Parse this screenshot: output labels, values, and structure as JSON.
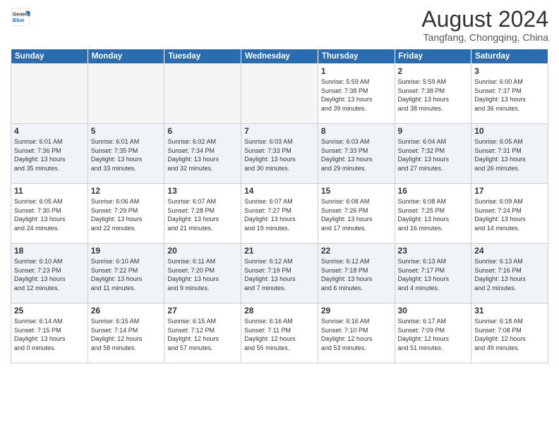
{
  "header": {
    "logo_line1": "General",
    "logo_line2": "Blue",
    "month_year": "August 2024",
    "location": "Tangfang, Chongqing, China"
  },
  "weekdays": [
    "Sunday",
    "Monday",
    "Tuesday",
    "Wednesday",
    "Thursday",
    "Friday",
    "Saturday"
  ],
  "weeks": [
    [
      {
        "day": "",
        "info": ""
      },
      {
        "day": "",
        "info": ""
      },
      {
        "day": "",
        "info": ""
      },
      {
        "day": "",
        "info": ""
      },
      {
        "day": "1",
        "info": "Sunrise: 5:59 AM\nSunset: 7:38 PM\nDaylight: 13 hours\nand 39 minutes."
      },
      {
        "day": "2",
        "info": "Sunrise: 5:59 AM\nSunset: 7:38 PM\nDaylight: 13 hours\nand 38 minutes."
      },
      {
        "day": "3",
        "info": "Sunrise: 6:00 AM\nSunset: 7:37 PM\nDaylight: 13 hours\nand 36 minutes."
      }
    ],
    [
      {
        "day": "4",
        "info": "Sunrise: 6:01 AM\nSunset: 7:36 PM\nDaylight: 13 hours\nand 35 minutes."
      },
      {
        "day": "5",
        "info": "Sunrise: 6:01 AM\nSunset: 7:35 PM\nDaylight: 13 hours\nand 33 minutes."
      },
      {
        "day": "6",
        "info": "Sunrise: 6:02 AM\nSunset: 7:34 PM\nDaylight: 13 hours\nand 32 minutes."
      },
      {
        "day": "7",
        "info": "Sunrise: 6:03 AM\nSunset: 7:33 PM\nDaylight: 13 hours\nand 30 minutes."
      },
      {
        "day": "8",
        "info": "Sunrise: 6:03 AM\nSunset: 7:33 PM\nDaylight: 13 hours\nand 29 minutes."
      },
      {
        "day": "9",
        "info": "Sunrise: 6:04 AM\nSunset: 7:32 PM\nDaylight: 13 hours\nand 27 minutes."
      },
      {
        "day": "10",
        "info": "Sunrise: 6:05 AM\nSunset: 7:31 PM\nDaylight: 13 hours\nand 26 minutes."
      }
    ],
    [
      {
        "day": "11",
        "info": "Sunrise: 6:05 AM\nSunset: 7:30 PM\nDaylight: 13 hours\nand 24 minutes."
      },
      {
        "day": "12",
        "info": "Sunrise: 6:06 AM\nSunset: 7:29 PM\nDaylight: 13 hours\nand 22 minutes."
      },
      {
        "day": "13",
        "info": "Sunrise: 6:07 AM\nSunset: 7:28 PM\nDaylight: 13 hours\nand 21 minutes."
      },
      {
        "day": "14",
        "info": "Sunrise: 6:07 AM\nSunset: 7:27 PM\nDaylight: 13 hours\nand 19 minutes."
      },
      {
        "day": "15",
        "info": "Sunrise: 6:08 AM\nSunset: 7:26 PM\nDaylight: 13 hours\nand 17 minutes."
      },
      {
        "day": "16",
        "info": "Sunrise: 6:08 AM\nSunset: 7:25 PM\nDaylight: 13 hours\nand 16 minutes."
      },
      {
        "day": "17",
        "info": "Sunrise: 6:09 AM\nSunset: 7:24 PM\nDaylight: 13 hours\nand 14 minutes."
      }
    ],
    [
      {
        "day": "18",
        "info": "Sunrise: 6:10 AM\nSunset: 7:23 PM\nDaylight: 13 hours\nand 12 minutes."
      },
      {
        "day": "19",
        "info": "Sunrise: 6:10 AM\nSunset: 7:22 PM\nDaylight: 13 hours\nand 11 minutes."
      },
      {
        "day": "20",
        "info": "Sunrise: 6:11 AM\nSunset: 7:20 PM\nDaylight: 13 hours\nand 9 minutes."
      },
      {
        "day": "21",
        "info": "Sunrise: 6:12 AM\nSunset: 7:19 PM\nDaylight: 13 hours\nand 7 minutes."
      },
      {
        "day": "22",
        "info": "Sunrise: 6:12 AM\nSunset: 7:18 PM\nDaylight: 13 hours\nand 6 minutes."
      },
      {
        "day": "23",
        "info": "Sunrise: 6:13 AM\nSunset: 7:17 PM\nDaylight: 13 hours\nand 4 minutes."
      },
      {
        "day": "24",
        "info": "Sunrise: 6:13 AM\nSunset: 7:16 PM\nDaylight: 13 hours\nand 2 minutes."
      }
    ],
    [
      {
        "day": "25",
        "info": "Sunrise: 6:14 AM\nSunset: 7:15 PM\nDaylight: 13 hours\nand 0 minutes."
      },
      {
        "day": "26",
        "info": "Sunrise: 6:15 AM\nSunset: 7:14 PM\nDaylight: 12 hours\nand 58 minutes."
      },
      {
        "day": "27",
        "info": "Sunrise: 6:15 AM\nSunset: 7:12 PM\nDaylight: 12 hours\nand 57 minutes."
      },
      {
        "day": "28",
        "info": "Sunrise: 6:16 AM\nSunset: 7:11 PM\nDaylight: 12 hours\nand 55 minutes."
      },
      {
        "day": "29",
        "info": "Sunrise: 6:16 AM\nSunset: 7:10 PM\nDaylight: 12 hours\nand 53 minutes."
      },
      {
        "day": "30",
        "info": "Sunrise: 6:17 AM\nSunset: 7:09 PM\nDaylight: 12 hours\nand 51 minutes."
      },
      {
        "day": "31",
        "info": "Sunrise: 6:18 AM\nSunset: 7:08 PM\nDaylight: 12 hours\nand 49 minutes."
      }
    ]
  ]
}
